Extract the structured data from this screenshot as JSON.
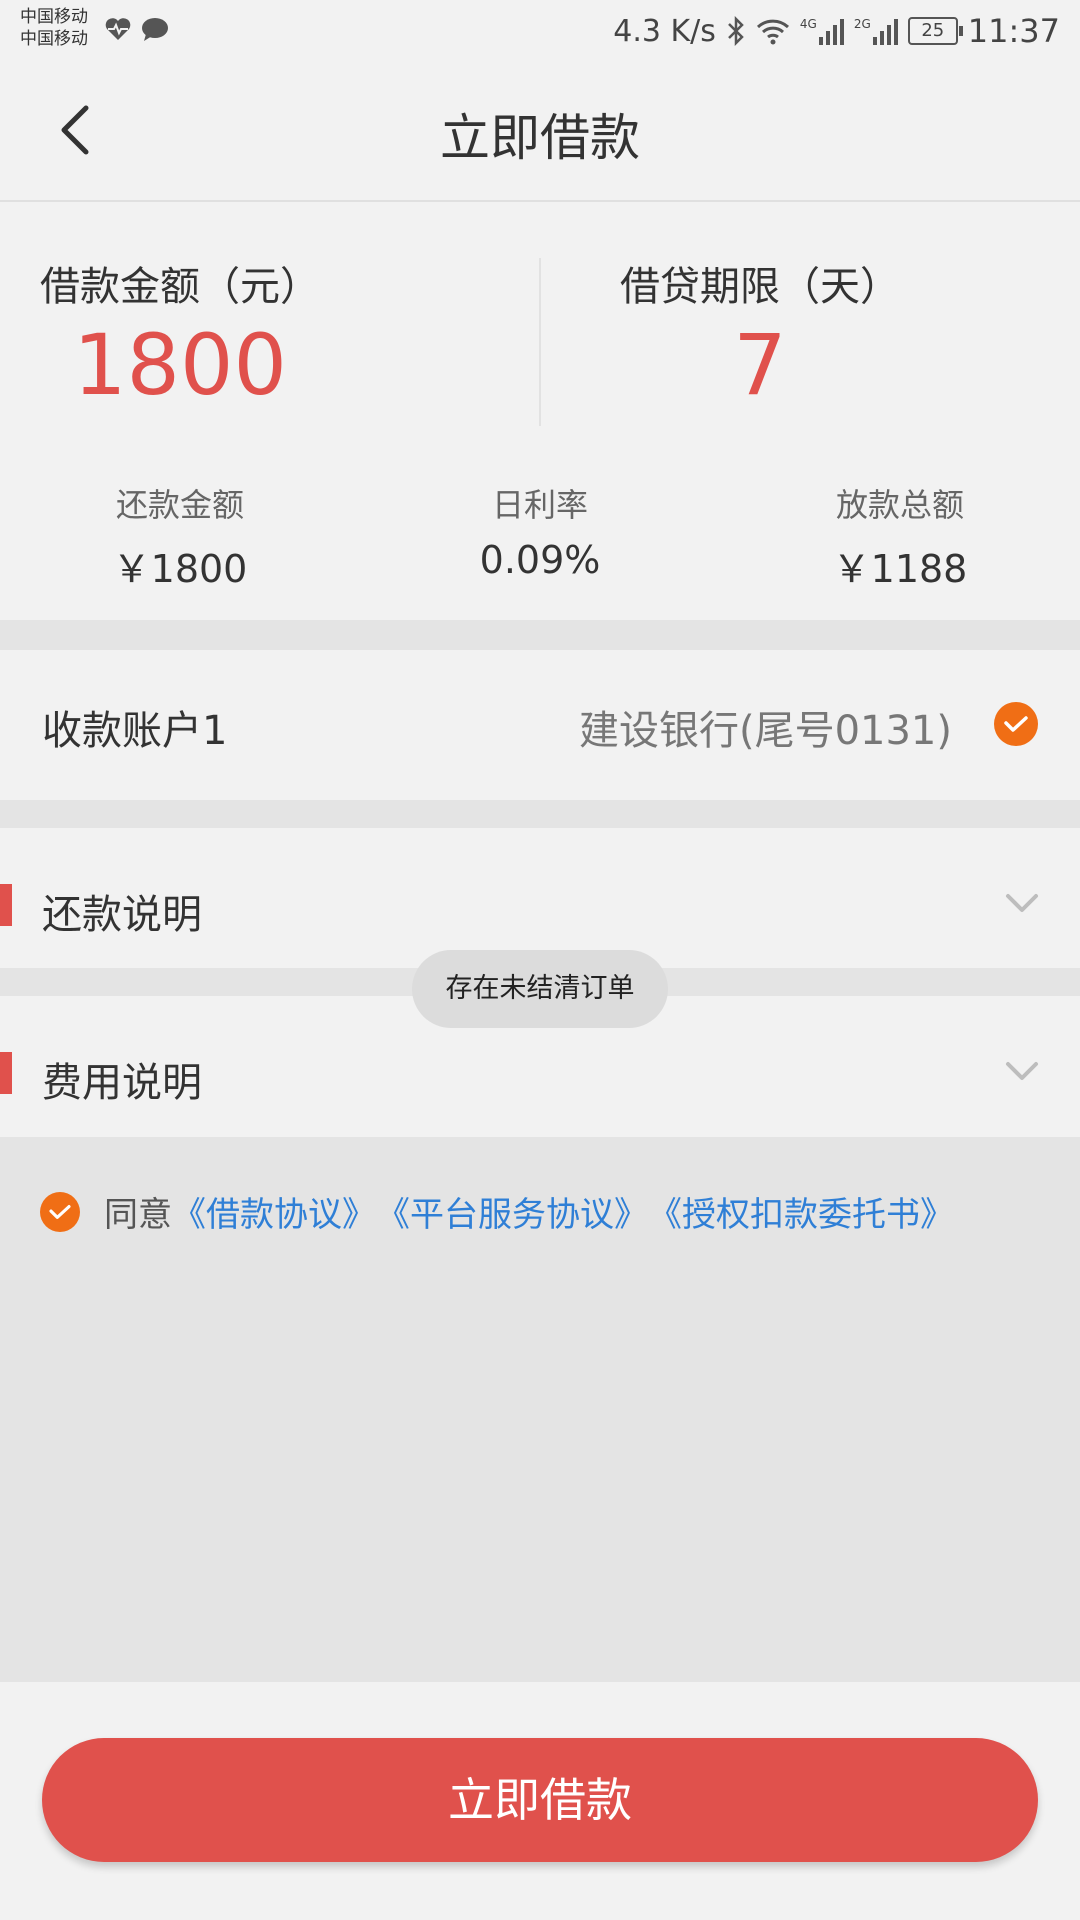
{
  "status_bar": {
    "carrier_1": "中国移动",
    "carrier_2": "中国移动",
    "net_speed": "4.3 K/s",
    "network_1": "4G",
    "network_2": "2G",
    "battery": "25",
    "time": "11:37"
  },
  "header": {
    "title": "立即借款"
  },
  "loan": {
    "amount_label": "借款金额（元）",
    "amount_value": "1800",
    "term_label": "借贷期限（天）",
    "term_value": "7"
  },
  "details": {
    "repay_label": "还款金额",
    "repay_value": "￥1800",
    "rate_label": "日利率",
    "rate_value": "0.09%",
    "payout_label": "放款总额",
    "payout_value": "￥1188"
  },
  "account": {
    "label": "收款账户1",
    "value": "建设银行(尾号0131)"
  },
  "sections": {
    "repayment_info": "还款说明",
    "fee_info": "费用说明"
  },
  "toast": "存在未结清订单",
  "agreement": {
    "prefix": "同意",
    "link_1": "《借款协议》",
    "link_2": "《平台服务协议》",
    "link_3": "《授权扣款委托书》"
  },
  "cta": {
    "label": "立即借款"
  },
  "colors": {
    "accent_red": "#e0514c",
    "check_orange": "#f06e15",
    "link_blue": "#2f7fd6"
  }
}
